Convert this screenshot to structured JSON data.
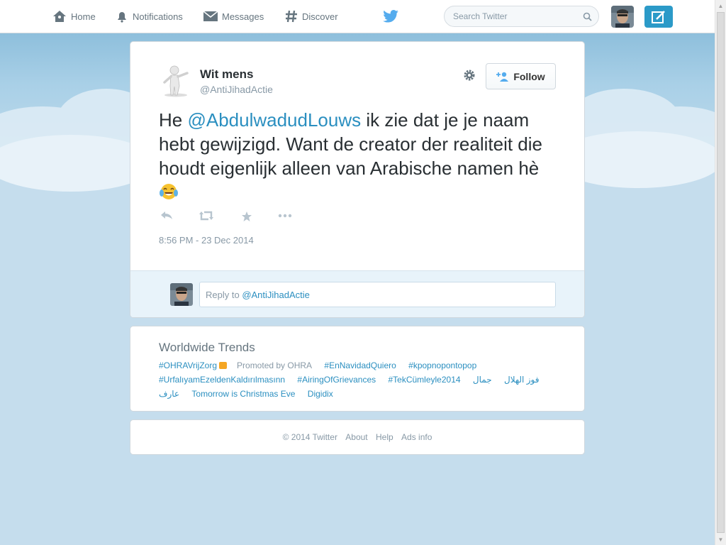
{
  "nav": {
    "home": "Home",
    "notifications": "Notifications",
    "messages": "Messages",
    "discover": "Discover"
  },
  "search": {
    "placeholder": "Search Twitter"
  },
  "tweet": {
    "author_name": "Wit mens",
    "author_handle": "@AntiJihadActie",
    "follow_label": "Follow",
    "text_before": "He ",
    "mention": "@AbdulwadudLouws",
    "text_after": " ik zie dat je je naam hebt gewijzigd. Want de creator der realiteit die houdt eigenlijk alleen van Arabische namen hè",
    "timestamp": "8:56 PM - 23 Dec 2014",
    "reply_prefix": "Reply to ",
    "reply_mention": "@AntiJihadActie"
  },
  "trends": {
    "title": "Worldwide Trends",
    "line1": [
      {
        "text": "#OHRAVrijZorg",
        "promoted": true,
        "promo_text": "Promoted by OHRA"
      },
      {
        "text": "#EnNavidadQuiero"
      },
      {
        "text": "#kpopnopontopop"
      }
    ],
    "line2": [
      {
        "text": "#UrfalıyamEzeldenKaldırılmasınn"
      },
      {
        "text": "#AiringOfGrievances"
      },
      {
        "text": "#TekCümleyle2014"
      },
      {
        "text": "فوز الهلال"
      },
      {
        "text": "جمال"
      }
    ],
    "line3": [
      {
        "text": "عارف"
      },
      {
        "text": "Tomorrow is Christmas Eve"
      },
      {
        "text": "Digidix"
      }
    ]
  },
  "footer": {
    "copyright": "© 2014 Twitter",
    "about": "About",
    "help": "Help",
    "ads": "Ads info"
  },
  "colors": {
    "accent": "#2b8fc0",
    "compose_bg": "#2b9ac8",
    "background": "#c5dded",
    "promoted_badge": "#f5a623"
  }
}
